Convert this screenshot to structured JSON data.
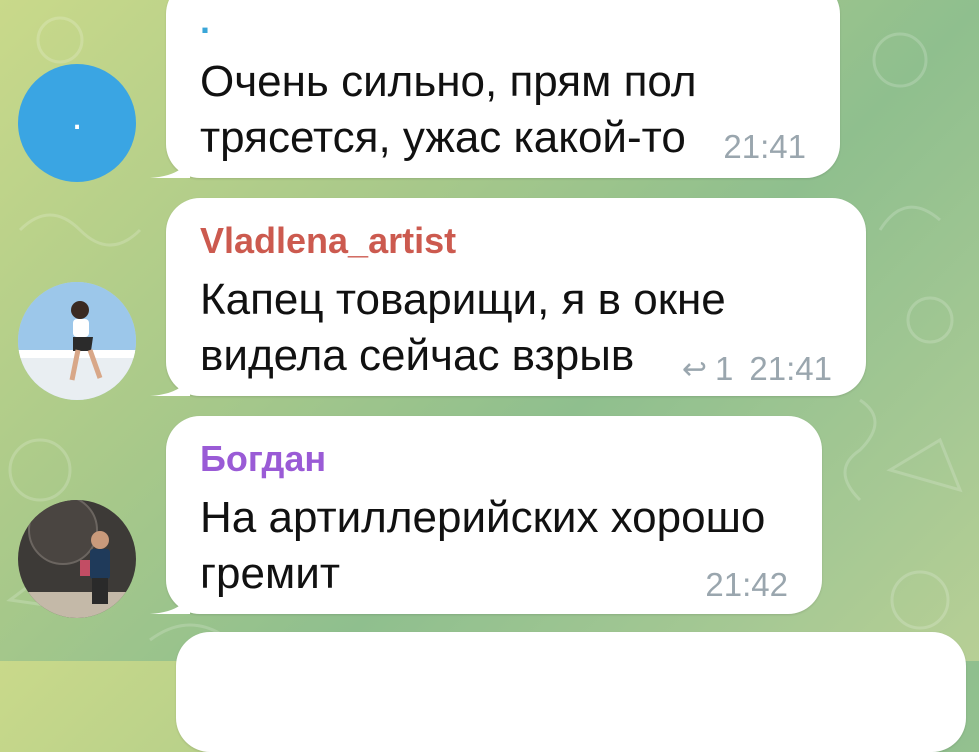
{
  "colors": {
    "sender_vladlena": "#cc5a4f",
    "sender_bogdan": "#9a5bd6",
    "sender_first": "#3aa6d8",
    "avatar_first": "#3aa5e3"
  },
  "messages": [
    {
      "sender": ".",
      "avatar_letter": ".",
      "lines": [
        "Очень сильно, прям пол",
        "трясется, ужас какой-то"
      ],
      "time": "21:41"
    },
    {
      "sender": "Vladlena_artist",
      "lines": [
        "Капец товарищи, я в окне",
        "видела сейчас взрыв"
      ],
      "reply_icon": "reply-arrow-icon",
      "reply_count": "1",
      "time": "21:41"
    },
    {
      "sender": "Богдан",
      "lines": [
        "На артиллерийских хорошо",
        "гремит"
      ],
      "time": "21:42"
    }
  ]
}
